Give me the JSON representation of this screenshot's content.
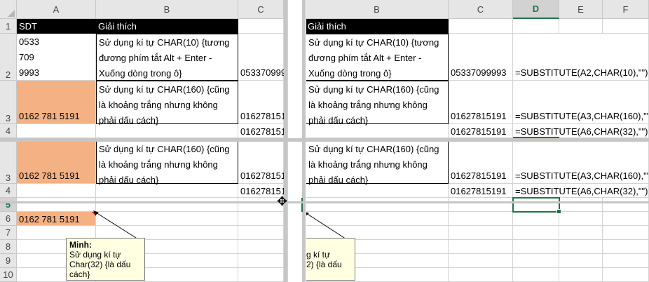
{
  "columns_left": [
    "A",
    "B",
    "C"
  ],
  "columns_right": [
    "B",
    "C",
    "D",
    "E",
    "F"
  ],
  "selected_column": "D",
  "rows_top": [
    "1",
    "2",
    "3",
    "4"
  ],
  "rows_bottom": [
    "3",
    "4",
    "5",
    "6",
    "7",
    "8",
    "9",
    "10"
  ],
  "selected_row": "5",
  "cells": {
    "a1": "SDT",
    "b1": "Giải thích",
    "a2_lines": [
      "0533",
      "709",
      "9993"
    ],
    "b2": "Sử dụng kí tự CHAR(10) {tương đương phím tắt Alt + Enter - Xuống dòng trong ô}",
    "c2": "05337099993",
    "d2": "=SUBSTITUTE(A2,CHAR(10),\"\")",
    "a3": "0162 781 5191",
    "b3": "Sử dụng kí tự CHAR(160) {cũng là khoảng trắng nhưng không phải dấu cách}",
    "c3": "01627815191",
    "d3": "=SUBSTITUTE(A3,CHAR(160),\"\")",
    "c4": "01627815191",
    "d4": "=SUBSTITUTE(A6,CHAR(32),\"\")",
    "a6": "0162 781 5191"
  },
  "comment": {
    "author": "Minh:",
    "text": "Sử dụng kí tự Char(32) {là dấu cách}",
    "text_partial": "g kí tự\n2) {là dấu"
  },
  "colors": {
    "header_fill": "#000000",
    "orange_fill": "#f4b183",
    "selection": "#217346",
    "comment_fill": "#ffffe1"
  }
}
